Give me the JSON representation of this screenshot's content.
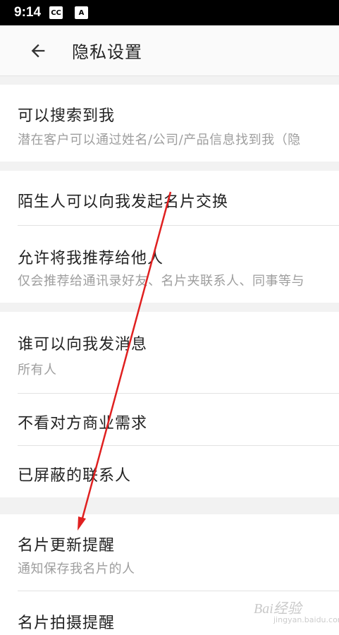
{
  "status_bar": {
    "time": "9:14",
    "icons": [
      "cc-icon",
      "a-icon"
    ],
    "icon_glyphs": [
      "CC",
      "A"
    ]
  },
  "app_bar": {
    "title": "隐私设置",
    "back_icon": "arrow-left-icon"
  },
  "settings": [
    {
      "label": "可以搜索到我",
      "sub": "潜在客户可以通过姓名/公司/产品信息找到我（隐"
    },
    {
      "label": "陌生人可以向我发起名片交换",
      "sub": ""
    },
    {
      "label": "允许将我推荐给他人",
      "sub": "仅会推荐给通讯录好友、名片夹联系人、同事等与"
    },
    {
      "label": "谁可以向我发消息",
      "sub": "所有人"
    },
    {
      "label": "不看对方商业需求",
      "sub": ""
    },
    {
      "label": "已屏蔽的联系人",
      "sub": ""
    },
    {
      "label": "名片更新提醒",
      "sub": "通知保存我名片的人"
    },
    {
      "label": "名片拍摄提醒",
      "sub": ""
    }
  ],
  "watermark": {
    "text": "Bai经验",
    "sub": "jingyan.baidu.com"
  },
  "colors": {
    "annotation_arrow": "#e02020",
    "section_gap": "#f2f2f2",
    "status_bar": "#000000"
  }
}
